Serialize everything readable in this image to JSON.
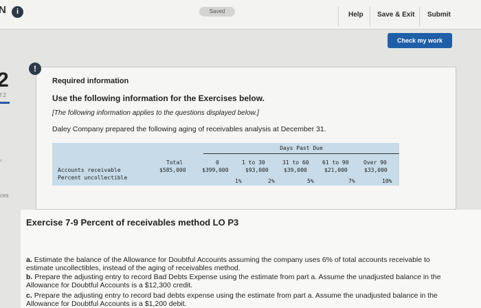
{
  "header": {
    "corner_text": "N",
    "info_icon": "info-icon",
    "saved_label": "Saved",
    "help_label": "Help",
    "save_exit_label": "Save & Exit",
    "submit_label": "Submit",
    "check_work_label": "Check my work"
  },
  "sidebar": {
    "question_number": "2",
    "item_1": "f 2",
    "item_2": "ces"
  },
  "required_info": {
    "title": "Required information",
    "subtitle": "Use the following information for the Exercises below.",
    "note": "[The following information applies to the questions displayed below.]",
    "intro": "Daley Company prepared the following aging of receivables analysis at December 31."
  },
  "aging_table": {
    "days_past_due_label": "Days Past Due",
    "columns": [
      "Total",
      "0",
      "1 to 30",
      "31 to 60",
      "61 to 90",
      "Over 90"
    ],
    "rows": [
      {
        "label": "Accounts receivable",
        "values": [
          "$585,000",
          "$399,000",
          "$93,000",
          "$39,000",
          "$21,000",
          "$33,000"
        ]
      },
      {
        "label": "Percent uncollectible",
        "values": [
          "",
          "",
          "1%",
          "2%",
          "5%",
          "7%",
          "10%"
        ]
      }
    ]
  },
  "exercise": {
    "title": "Exercise 7-9 Percent of receivables method LO P3",
    "part_a_letter": "a.",
    "part_a": "Estimate the balance of the Allowance for Doubtful Accounts assuming the company uses 6% of total accounts receivable to estimate uncollectibles, instead of the aging of receivables method.",
    "part_b_letter": "b.",
    "part_b": "Prepare the adjusting entry to record Bad Debts Expense using the estimate from part a. Assume the unadjusted balance in the Allowance for Doubtful Accounts is a $12,300 credit.",
    "part_c_letter": "c.",
    "part_c": "Prepare the adjusting entry to record bad debts expense using the estimate from part a. Assume the unadjusted balance in the Allowance for Doubtful Accounts is a $1,200 debit."
  }
}
